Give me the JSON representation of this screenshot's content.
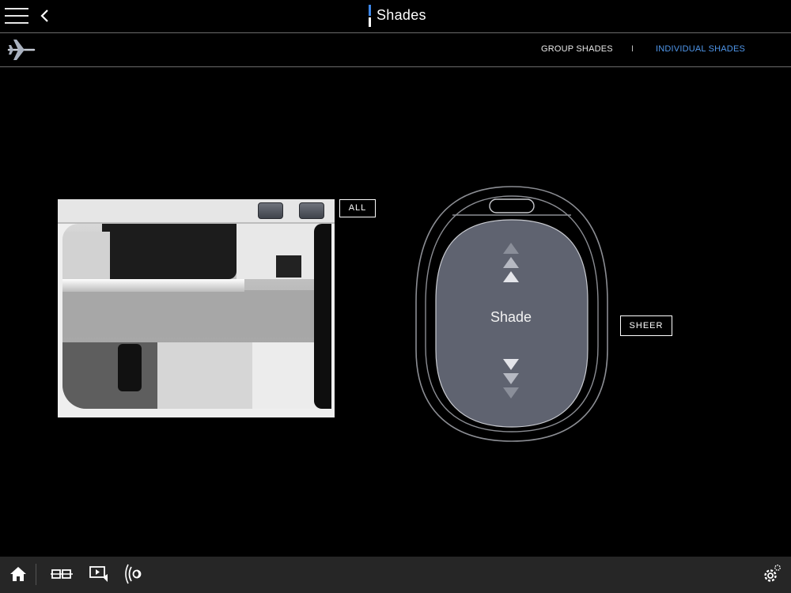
{
  "header": {
    "title": "Shades",
    "menu_icon": "hamburger-menu-icon",
    "back_icon": "chevron-left-icon",
    "accent_color": "#3d87e8"
  },
  "subheader": {
    "aircraft_icon": "airplane-icon",
    "tabs": [
      {
        "label": "GROUP SHADES",
        "active": false
      },
      {
        "label": "INDIVIDUAL SHADES",
        "active": true
      }
    ],
    "separator": "I",
    "active_color": "#4f96ea"
  },
  "cabin": {
    "all_label": "ALL"
  },
  "shade": {
    "label": "Shade",
    "up_icon": "triple-arrow-up-icon",
    "down_icon": "triple-arrow-down-icon",
    "sheer_label": "SHEER"
  },
  "bottom_bar": {
    "icons": [
      "home-icon",
      "seats-icon",
      "media-icon",
      "audio-icon",
      "settings-icon"
    ]
  }
}
